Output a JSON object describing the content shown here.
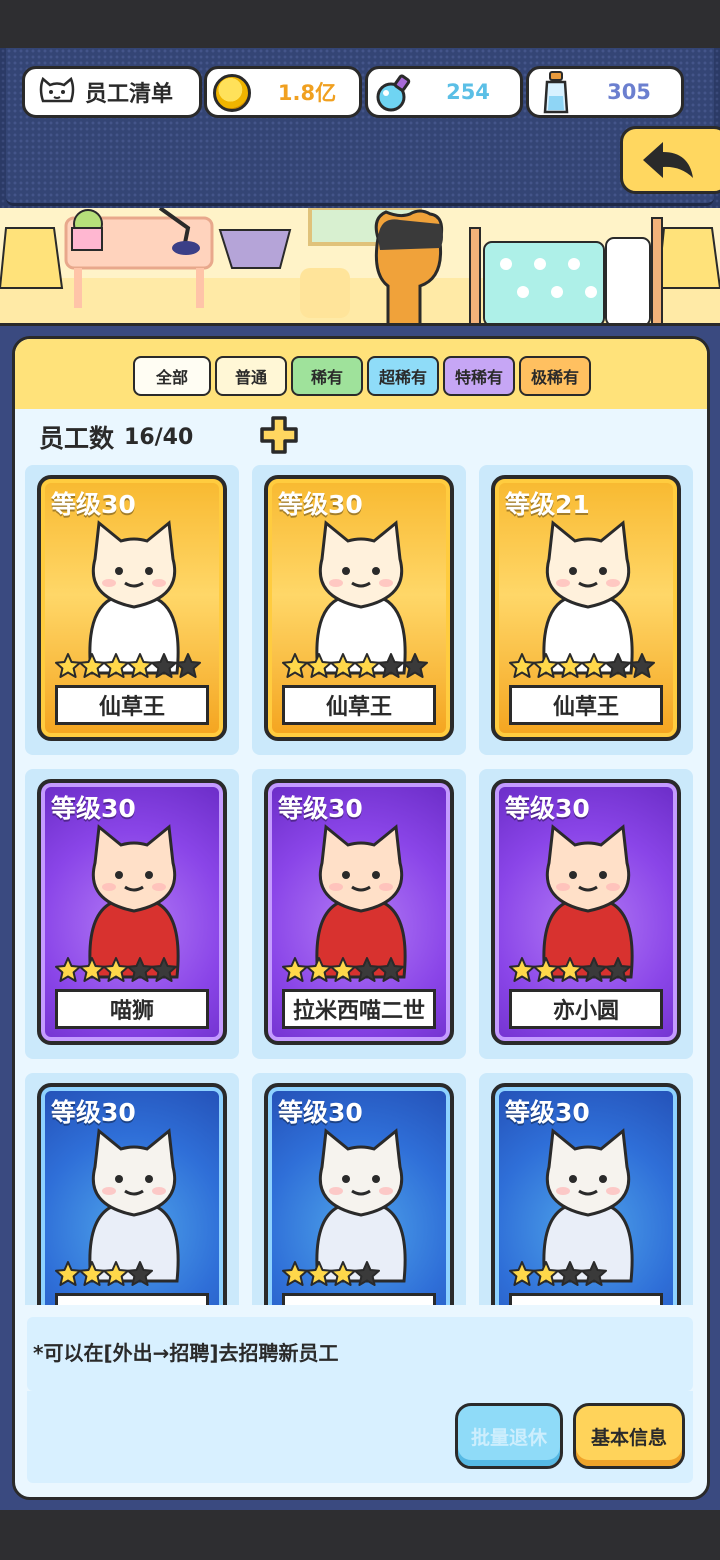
{
  "header": {
    "title": "员工清单",
    "currencies": [
      {
        "icon": "gold-coin-icon",
        "value": "1.8亿",
        "color": "#f0a020"
      },
      {
        "icon": "potion-flask-icon",
        "value": "254",
        "color": "#5bbfe6"
      },
      {
        "icon": "water-bottle-icon",
        "value": "305",
        "color": "#6b7fcf"
      }
    ]
  },
  "filters": [
    "全部",
    "普通",
    "稀有",
    "超稀有",
    "特稀有",
    "极稀有"
  ],
  "staff": {
    "count_label": "员工数",
    "count_value": "16/40",
    "cards": [
      {
        "level": "等级30",
        "name": "仙草王",
        "stars": 4,
        "max_stars": 6,
        "rarity": "gold"
      },
      {
        "level": "等级30",
        "name": "仙草王",
        "stars": 4,
        "max_stars": 6,
        "rarity": "gold"
      },
      {
        "level": "等级21",
        "name": "仙草王",
        "stars": 4,
        "max_stars": 6,
        "rarity": "gold"
      },
      {
        "level": "等级30",
        "name": "喵狮",
        "stars": 3,
        "max_stars": 5,
        "rarity": "purple"
      },
      {
        "level": "等级30",
        "name": "拉米西喵二世",
        "stars": 3,
        "max_stars": 5,
        "rarity": "purple"
      },
      {
        "level": "等级30",
        "name": "亦小圆",
        "stars": 3,
        "max_stars": 5,
        "rarity": "purple"
      },
      {
        "level": "等级30",
        "name": "",
        "stars": 3,
        "max_stars": 4,
        "rarity": "blue"
      },
      {
        "level": "等级30",
        "name": "",
        "stars": 3,
        "max_stars": 4,
        "rarity": "blue"
      },
      {
        "level": "等级30",
        "name": "",
        "stars": 2,
        "max_stars": 4,
        "rarity": "blue"
      }
    ]
  },
  "footer": {
    "hint": "*可以在[外出→招聘]去招聘新员工",
    "retire_button": "批量退休",
    "info_button": "基本信息"
  }
}
